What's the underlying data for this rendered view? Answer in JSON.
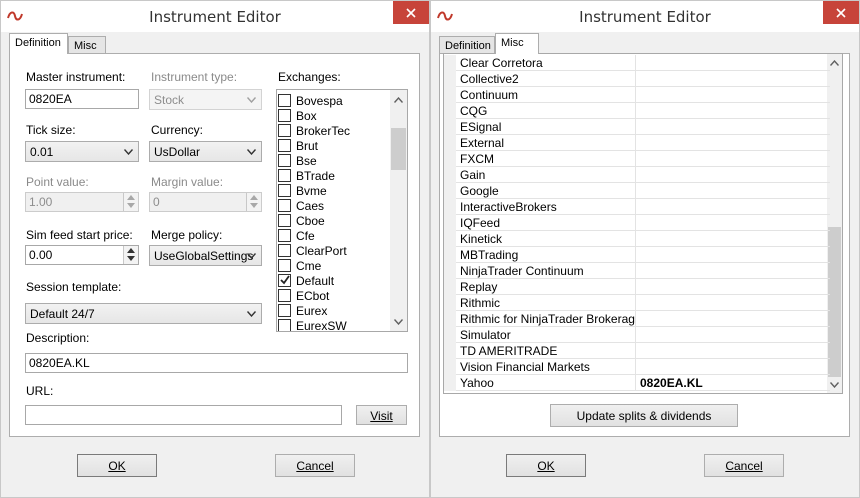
{
  "left_window": {
    "title": "Instrument Editor",
    "tabs": [
      "Definition",
      "Misc"
    ],
    "master_instrument": {
      "label": "Master instrument:",
      "value": "0820EA"
    },
    "instrument_type": {
      "label": "Instrument type:",
      "value": "Stock"
    },
    "exchanges": {
      "label": "Exchanges:",
      "items": [
        {
          "name": "Bovespa",
          "checked": false
        },
        {
          "name": "Box",
          "checked": false
        },
        {
          "name": "BrokerTec",
          "checked": false
        },
        {
          "name": "Brut",
          "checked": false
        },
        {
          "name": "Bse",
          "checked": false
        },
        {
          "name": "BTrade",
          "checked": false
        },
        {
          "name": "Bvme",
          "checked": false
        },
        {
          "name": "Caes",
          "checked": false
        },
        {
          "name": "Cboe",
          "checked": false
        },
        {
          "name": "Cfe",
          "checked": false
        },
        {
          "name": "ClearPort",
          "checked": false
        },
        {
          "name": "Cme",
          "checked": false
        },
        {
          "name": "Default",
          "checked": true
        },
        {
          "name": "ECbot",
          "checked": false
        },
        {
          "name": "Eurex",
          "checked": false
        },
        {
          "name": "EurexSW",
          "checked": false
        }
      ]
    },
    "tick_size": {
      "label": "Tick size:",
      "value": "0.01"
    },
    "currency": {
      "label": "Currency:",
      "value": "UsDollar"
    },
    "point_value": {
      "label": "Point value:",
      "value": "1.00"
    },
    "margin_value": {
      "label": "Margin value:",
      "value": "0"
    },
    "sim_feed_start_price": {
      "label": "Sim feed start price:",
      "value": "0.00"
    },
    "merge_policy": {
      "label": "Merge policy:",
      "value": "UseGlobalSettings"
    },
    "session_template": {
      "label": "Session template:",
      "value": "Default 24/7"
    },
    "description": {
      "label": "Description:",
      "value": "0820EA.KL"
    },
    "url": {
      "label": "URL:",
      "value": ""
    },
    "visit_button": "Visit",
    "ok_button": "OK",
    "cancel_button": "Cancel"
  },
  "right_window": {
    "title": "Instrument Editor",
    "tabs": [
      "Definition",
      "Misc"
    ],
    "providers": [
      {
        "name": "Clear Corretora",
        "value": ""
      },
      {
        "name": "Collective2",
        "value": ""
      },
      {
        "name": "Continuum",
        "value": ""
      },
      {
        "name": "CQG",
        "value": ""
      },
      {
        "name": "ESignal",
        "value": ""
      },
      {
        "name": "External",
        "value": ""
      },
      {
        "name": "FXCM",
        "value": ""
      },
      {
        "name": "Gain",
        "value": ""
      },
      {
        "name": "Google",
        "value": ""
      },
      {
        "name": "InteractiveBrokers",
        "value": ""
      },
      {
        "name": "IQFeed",
        "value": ""
      },
      {
        "name": "Kinetick",
        "value": ""
      },
      {
        "name": "MBTrading",
        "value": ""
      },
      {
        "name": "NinjaTrader Continuum",
        "value": ""
      },
      {
        "name": "Replay",
        "value": ""
      },
      {
        "name": "Rithmic",
        "value": ""
      },
      {
        "name": "Rithmic for NinjaTrader Brokerage",
        "value": ""
      },
      {
        "name": "Simulator",
        "value": ""
      },
      {
        "name": "TD AMERITRADE",
        "value": ""
      },
      {
        "name": "Vision Financial Markets",
        "value": ""
      },
      {
        "name": "Yahoo",
        "value": "0820EA.KL"
      }
    ],
    "update_button": "Update splits & dividends",
    "ok_button": "OK",
    "cancel_button": "Cancel"
  },
  "colors": {
    "close_button": "#c7443a",
    "window_bg": "#f0f0f0",
    "icon_red": "#c0392b"
  }
}
